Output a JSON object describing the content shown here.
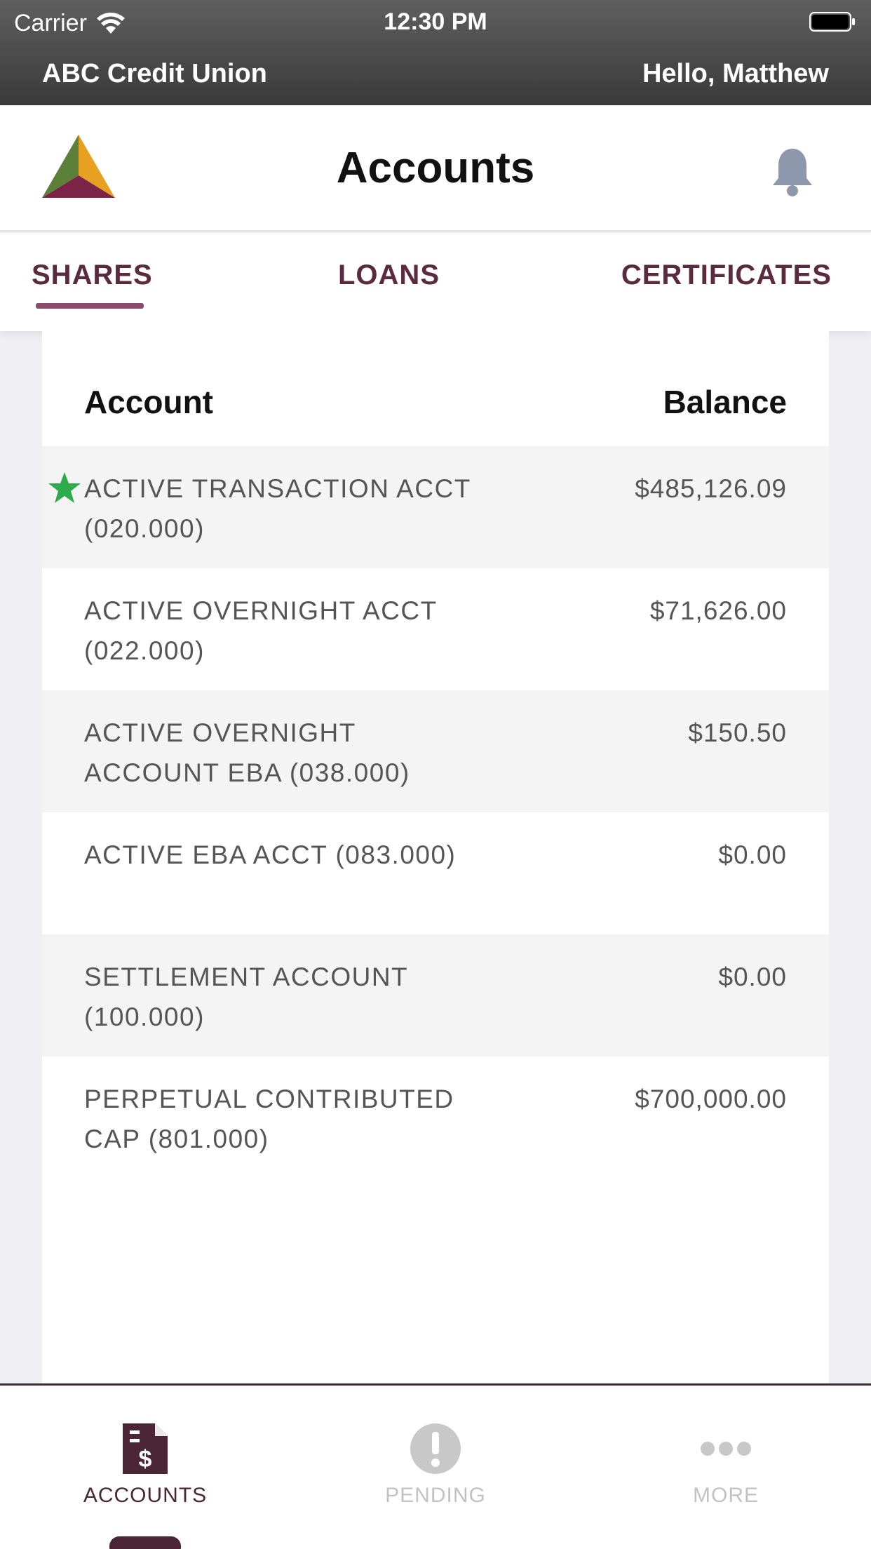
{
  "status_bar": {
    "carrier": "Carrier",
    "time": "12:30 PM"
  },
  "header": {
    "institution": "ABC Credit Union",
    "greeting": "Hello, Matthew"
  },
  "title_bar": {
    "title": "Accounts"
  },
  "tabs": [
    {
      "label": "SHARES",
      "selected": true
    },
    {
      "label": "LOANS",
      "selected": false
    },
    {
      "label": "CERTIFICATES",
      "selected": false
    }
  ],
  "table": {
    "headers": {
      "account": "Account",
      "balance": "Balance"
    },
    "rows": [
      {
        "name": "ACTIVE TRANSACTION ACCT (020.000)",
        "balance": "$485,126.09",
        "favorite": true
      },
      {
        "name": "ACTIVE OVERNIGHT ACCT (022.000)",
        "balance": "$71,626.00",
        "favorite": false
      },
      {
        "name": "ACTIVE OVERNIGHT ACCOUNT EBA (038.000)",
        "balance": "$150.50",
        "favorite": false
      },
      {
        "name": "ACTIVE EBA ACCT (083.000)",
        "balance": "$0.00",
        "favorite": false
      },
      {
        "name": "SETTLEMENT ACCOUNT (100.000)",
        "balance": "$0.00",
        "favorite": false
      },
      {
        "name": "PERPETUAL CONTRIBUTED CAP (801.000)",
        "balance": "$700,000.00",
        "favorite": false
      }
    ]
  },
  "tab_bar": [
    {
      "label": "ACCOUNTS",
      "icon": "document-dollar-icon",
      "active": true
    },
    {
      "label": "PENDING",
      "icon": "exclamation-circle-icon",
      "active": false
    },
    {
      "label": "MORE",
      "icon": "ellipsis-icon",
      "active": false
    }
  ],
  "colors": {
    "accent": "#8c4a6c",
    "brand_dark": "#4a2636",
    "favorite_star": "#2eab4a"
  }
}
